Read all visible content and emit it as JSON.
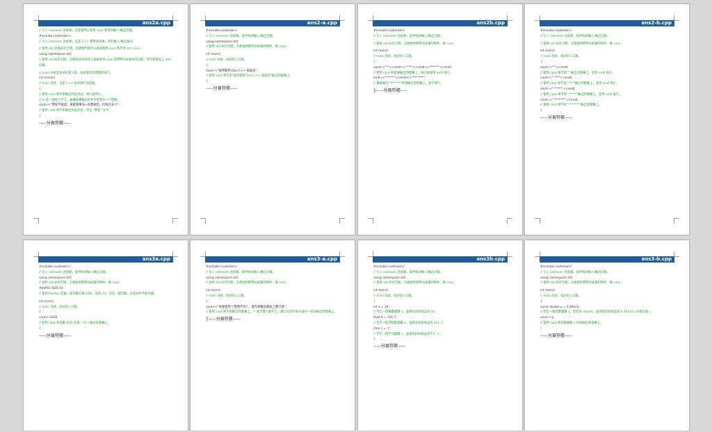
{
  "colors": {
    "header_bar": "#1f5c99",
    "comment": "#2e9e3a",
    "code": "#333333",
    "workspace": "#d8d8d8"
  },
  "pages": [
    {
      "title": "ans2a.cpp",
      "lines": [
        {
          "t": "// 引入 iostream 函式庫，這是使用以使用 cout 等等的輸入/輸出功能。",
          "c": "cm"
        },
        {
          "t": "#include<iostream>",
          "c": ""
        },
        {
          "t": "// 引入 iostream 函式庫，這是 C++ 標準函式庫，用於輸入/輸出操作。",
          "c": "cm"
        },
        {
          "t": "",
          "c": "gap"
        },
        {
          "t": "// 使用 std 這個命名空間，這樣我們就可以直接使用 cout 而不用 std::cout。",
          "c": "cm"
        },
        {
          "t": "using namespace std;",
          "c": ""
        },
        {
          "t": "// 使用 std 命名空間，這樣程式中就可以直接使用 cout 等標準函式庫中的功能，而不需要加上 std:: 前綴。",
          "c": "cm wrap"
        },
        {
          "t": "",
          "c": "gap"
        },
        {
          "t": "// main 函式是程式的進入點，程式會從這裡開始執行。",
          "c": "cm"
        },
        {
          "t": "int main(){",
          "c": ""
        },
        {
          "t": "// main 函式，這是 C++ 程式執行的起點。",
          "c": "cm"
        },
        {
          "t": "{",
          "c": ""
        },
        {
          "t": "// 使用 cout 將字串輸出到主控台，換行使用\\n。",
          "c": "cm"
        },
        {
          "t": "// \\n 是一個換行字元，會讓接續輸出的文字從新的一行開始。",
          "c": "cm"
        },
        {
          "t": "    cout<<\"學程不能錯，誰能管事海=有賣家吃，均每次多少\";",
          "c": ""
        },
        {
          "t": "// 使用 cout 將字串輸出到主控台，印出 \"學程\" 文字。",
          "c": "cm wrap"
        },
        {
          "t": "}",
          "c": ""
        },
        {
          "t": "-----分頁符號-----",
          "c": "big"
        }
      ]
    },
    {
      "title": "ans2-a.cpp",
      "lines": [
        {
          "t": "#include<iostream>",
          "c": ""
        },
        {
          "t": "// 引入 iostream 函式庫，提供程式輸入/輸出功能。",
          "c": "cm"
        },
        {
          "t": "using namespace std;",
          "c": ""
        },
        {
          "t": "// 使用 std 命名空間，方便使用標準函式庫的物件，像 cout。",
          "c": "cm"
        },
        {
          "t": "",
          "c": "gap"
        },
        {
          "t": "int main()",
          "c": ""
        },
        {
          "t": "// main 函式，程式的入口點。",
          "c": "cm"
        },
        {
          "t": "{",
          "c": ""
        },
        {
          "t": "    cout<<\"啟用使用 Dev-C++ 寫程式\";",
          "c": ""
        },
        {
          "t": "// 使用 cout 將字串\"啟用使用 Dev-C++ 寫程式\"輸出到螢幕上。",
          "c": "cm"
        },
        {
          "t": "}",
          "c": ""
        },
        {
          "t": "-----分頁符號-----",
          "c": "big"
        }
      ]
    },
    {
      "title": "ans2b.cpp",
      "lines": [
        {
          "t": "#include<iostream>",
          "c": ""
        },
        {
          "t": "// 引入 iostream 函式庫，提供程式輸入/輸出功能。",
          "c": "cm"
        },
        {
          "t": "",
          "c": "gap"
        },
        {
          "t": "// 使用 std 命名空間，方便使用標準函式庫的物件，像 cout。",
          "c": "cm"
        },
        {
          "t": "",
          "c": "gap"
        },
        {
          "t": "int main()",
          "c": ""
        },
        {
          "t": "// main 函式，程式的入口點。",
          "c": "cm"
        },
        {
          "t": "{",
          "c": ""
        },
        {
          "t": "    cout<<\"*\"<<endl<<\"***\"<<endl<<\"*****\"<<endl;",
          "c": ""
        },
        {
          "t": "// 使用 cout 將星號輸出到螢幕上，每行後使用 endl 換行。",
          "c": "cm wrap"
        },
        {
          "t": "    endl<<\"*****\"<<endl<<\"*******\";",
          "c": ""
        },
        {
          "t": "// 最後輸出\"*******\"星號輸出到螢幕上，並不換行。",
          "c": "cm"
        },
        {
          "t": "}-----分頁符號-----",
          "c": "big"
        }
      ]
    },
    {
      "title": "ans2-b.cpp",
      "lines": [
        {
          "t": "#include<iostream>",
          "c": ""
        },
        {
          "t": "// 引入 iostream 函式庫，提供程式輸入/輸出功能。",
          "c": "cm"
        },
        {
          "t": "",
          "c": "gap"
        },
        {
          "t": "// 使用 std 命名空間，方便使用標準函式庫的物件，像 cout。",
          "c": "cm"
        },
        {
          "t": "",
          "c": "gap"
        },
        {
          "t": "int main()",
          "c": ""
        },
        {
          "t": "// main 函式，程式的入口點。",
          "c": "cm"
        },
        {
          "t": "{",
          "c": ""
        },
        {
          "t": "    cout<<\"*\"<<endl;",
          "c": ""
        },
        {
          "t": "// 使用 cout 將字串\"*\"輸出到螢幕上，並用 endl 換行。",
          "c": "cm"
        },
        {
          "t": "    cout<<\" ***\"<<endl;",
          "c": ""
        },
        {
          "t": "// 使用 cout 將字串\" ***\"輸出到螢幕上，並用 endl 換行。",
          "c": "cm"
        },
        {
          "t": "    cout<<\"  *****\"<<endl;",
          "c": ""
        },
        {
          "t": "// 使用 cout 將字串\"  *****\"輸出到螢幕上，並用 endl 換行。",
          "c": "cm"
        },
        {
          "t": "    cout<<\"   *******\"<<endl;",
          "c": ""
        },
        {
          "t": "// 使用 cout 將字串\"   *******\"輸出到螢幕上。",
          "c": "cm"
        },
        {
          "t": "}",
          "c": ""
        },
        {
          "t": "-----分頁符號-----",
          "c": "big"
        }
      ]
    },
    {
      "title": "ans3a.cpp",
      "lines": [
        {
          "t": "#include<iostream>",
          "c": ""
        },
        {
          "t": "// 引入 iostream 函式庫，提供程式輸入/輸出功能。",
          "c": "cm"
        },
        {
          "t": "using namespace std;",
          "c": ""
        },
        {
          "t": "// 使用 std 命名空間，方便使用標準函式庫的物件，像 cout。",
          "c": "cm"
        },
        {
          "t": "#define SIZE 10",
          "c": ""
        },
        {
          "t": "// 使用#define 定義一個常數名稱 SIZE，值為 10，這是一個常數，在程式中不能改變。",
          "c": "cm wrap"
        },
        {
          "t": "",
          "c": "gap"
        },
        {
          "t": "int main()",
          "c": ""
        },
        {
          "t": "// main 函式，程式的入口點。",
          "c": "cm"
        },
        {
          "t": "{",
          "c": ""
        },
        {
          "t": "    cout<<SIZE;",
          "c": ""
        },
        {
          "t": "// 使用 cout 將常數 SIZE 的值 ( 10 ) 輸出到螢幕上。",
          "c": "cm"
        },
        {
          "t": "}",
          "c": ""
        },
        {
          "t": "-----分頁符號-----",
          "c": "big"
        }
      ]
    },
    {
      "title": "ans3-a.cpp",
      "lines": [
        {
          "t": "#include<iostream>",
          "c": ""
        },
        {
          "t": "// 引入 iostream 函式庫，提供程式輸入/輸出功能。",
          "c": "cm"
        },
        {
          "t": "using namespace std;",
          "c": ""
        },
        {
          "t": "// 使用 std 命名空間，方便使用標準函式庫的物件，像 cout。",
          "c": "cm"
        },
        {
          "t": "",
          "c": "gap"
        },
        {
          "t": "int main()",
          "c": ""
        },
        {
          "t": "// main 函式，程式的入口點。",
          "c": "cm"
        },
        {
          "t": "{",
          "c": ""
        },
        {
          "t": "    cout<<\"你會使用 \\\"我我字符\\\"，當作將數形都加上雙引號\";",
          "c": ""
        },
        {
          "t": "// 使用 cout 將字串輸出到螢幕上，\\\" 表示雙引號字元，讓它作為字串內容的一部分輸出到螢幕上。",
          "c": "cm wrap"
        },
        {
          "t": "}-----分頁符號-----",
          "c": "big"
        }
      ]
    },
    {
      "title": "ans3b.cpp",
      "lines": [
        {
          "t": "#include<iostream>",
          "c": ""
        },
        {
          "t": "// 引入 iostream 函式庫，提供程式輸入/輸出功能。",
          "c": "cm"
        },
        {
          "t": "using namespace std;",
          "c": ""
        },
        {
          "t": "// 使用 std 命名空間，方便使用標準函式庫的物件，像 cout。",
          "c": "cm"
        },
        {
          "t": "",
          "c": "gap"
        },
        {
          "t": "int main()",
          "c": ""
        },
        {
          "t": "// main 函式，程式的入口點。",
          "c": "cm"
        },
        {
          "t": "{",
          "c": ""
        },
        {
          "t": "    int a = 10;",
          "c": ""
        },
        {
          "t": "// 宣告一個整數變數 a，並將其初始值設為 10。",
          "c": "cm"
        },
        {
          "t": "    float b = 101.7;",
          "c": ""
        },
        {
          "t": "// 宣告一個浮點數變數 b，並將其初始值設為 101.7。",
          "c": "cm"
        },
        {
          "t": "    char c = 'c';",
          "c": ""
        },
        {
          "t": "// 宣告一個字元變數 c，並將其初始值設為字元 'c'。",
          "c": "cm"
        },
        {
          "t": "}",
          "c": ""
        },
        {
          "t": "-----分頁符號-----",
          "c": "big"
        }
      ]
    },
    {
      "title": "ans3-b.cpp",
      "lines": [
        {
          "t": "#include<iostream>",
          "c": ""
        },
        {
          "t": "// 引入 iostream 函式庫，提供程式輸入/輸出功能。",
          "c": "cm"
        },
        {
          "t": "using namespace std;",
          "c": ""
        },
        {
          "t": "// 使用 std 命名空間，方便使用標準函式庫的物件，像 cout。",
          "c": "cm"
        },
        {
          "t": "",
          "c": "gap"
        },
        {
          "t": "int main()",
          "c": ""
        },
        {
          "t": "// main 函式，程式的入口點。",
          "c": "cm"
        },
        {
          "t": "{",
          "c": ""
        },
        {
          "t": "    const double y = 6.46e12;",
          "c": ""
        },
        {
          "t": "// 宣告一個常數變數 y，型別為 double，並將其初始值設為 6.46e12 ( 科學記號 )。",
          "c": "cm wrap"
        },
        {
          "t": "    cout<<y;",
          "c": ""
        },
        {
          "t": "// 使用 cout 將常數變數 y 的值輸出到螢幕上。",
          "c": "cm"
        },
        {
          "t": "}",
          "c": ""
        },
        {
          "t": "-----分頁符號-----",
          "c": "big"
        }
      ]
    }
  ]
}
